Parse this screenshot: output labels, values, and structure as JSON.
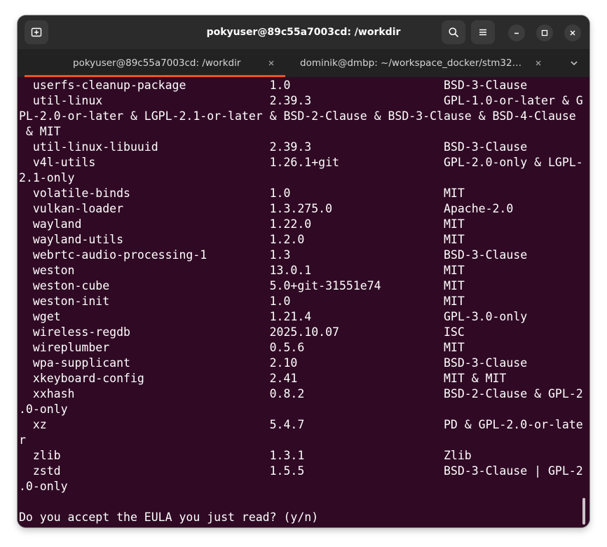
{
  "window": {
    "title": "pokyuser@89c55a7003cd: /workdir",
    "new_tab_icon": "new-tab-icon",
    "search_icon": "search-icon",
    "menu_icon": "hamburger-menu-icon",
    "minimize_icon": "minimize-icon",
    "maximize_icon": "maximize-icon",
    "close_icon": "close-icon"
  },
  "tabs": [
    {
      "label": "pokyuser@89c55a7003cd: /workdir",
      "active": true,
      "close": "×"
    },
    {
      "label": "dominik@dmbp: ~/workspace_docker/stm32…",
      "active": false,
      "close": "×"
    }
  ],
  "tab_overflow_icon": "chevron-down-icon",
  "theme": {
    "terminal_bg": "#300a24",
    "titlebar_bg": "#2b2b2b",
    "tabbar_bg": "#222222",
    "accent": "#e95420",
    "text": "#ffffff"
  },
  "terminal": {
    "lines": [
      "  userfs-cleanup-package            1.0                      BSD-3-Clause",
      "  util-linux                        2.39.3                   GPL-1.0-or-later & G",
      "PL-2.0-or-later & LGPL-2.1-or-later & BSD-2-Clause & BSD-3-Clause & BSD-4-Clause",
      " & MIT",
      "  util-linux-libuuid                2.39.3                   BSD-3-Clause",
      "  v4l-utils                         1.26.1+git               GPL-2.0-only & LGPL-",
      "2.1-only",
      "  volatile-binds                    1.0                      MIT",
      "  vulkan-loader                     1.3.275.0                Apache-2.0",
      "  wayland                           1.22.0                   MIT",
      "  wayland-utils                     1.2.0                    MIT",
      "  webrtc-audio-processing-1         1.3                      BSD-3-Clause",
      "  weston                            13.0.1                   MIT",
      "  weston-cube                       5.0+git-31551e74         MIT",
      "  weston-init                       1.0                      MIT",
      "  wget                              1.21.4                   GPL-3.0-only",
      "  wireless-regdb                    2025.10.07               ISC",
      "  wireplumber                       0.5.6                    MIT",
      "  wpa-supplicant                    2.10                     BSD-3-Clause",
      "  xkeyboard-config                  2.41                     MIT & MIT",
      "  xxhash                            0.8.2                    BSD-2-Clause & GPL-2",
      ".0-only",
      "  xz                                5.4.7                    PD & GPL-2.0-or-late",
      "r",
      "  zlib                              1.3.1                    Zlib",
      "  zstd                              1.5.5                    BSD-3-Clause | GPL-2",
      ".0-only",
      "",
      "Do you accept the EULA you just read? (y/n)"
    ]
  }
}
